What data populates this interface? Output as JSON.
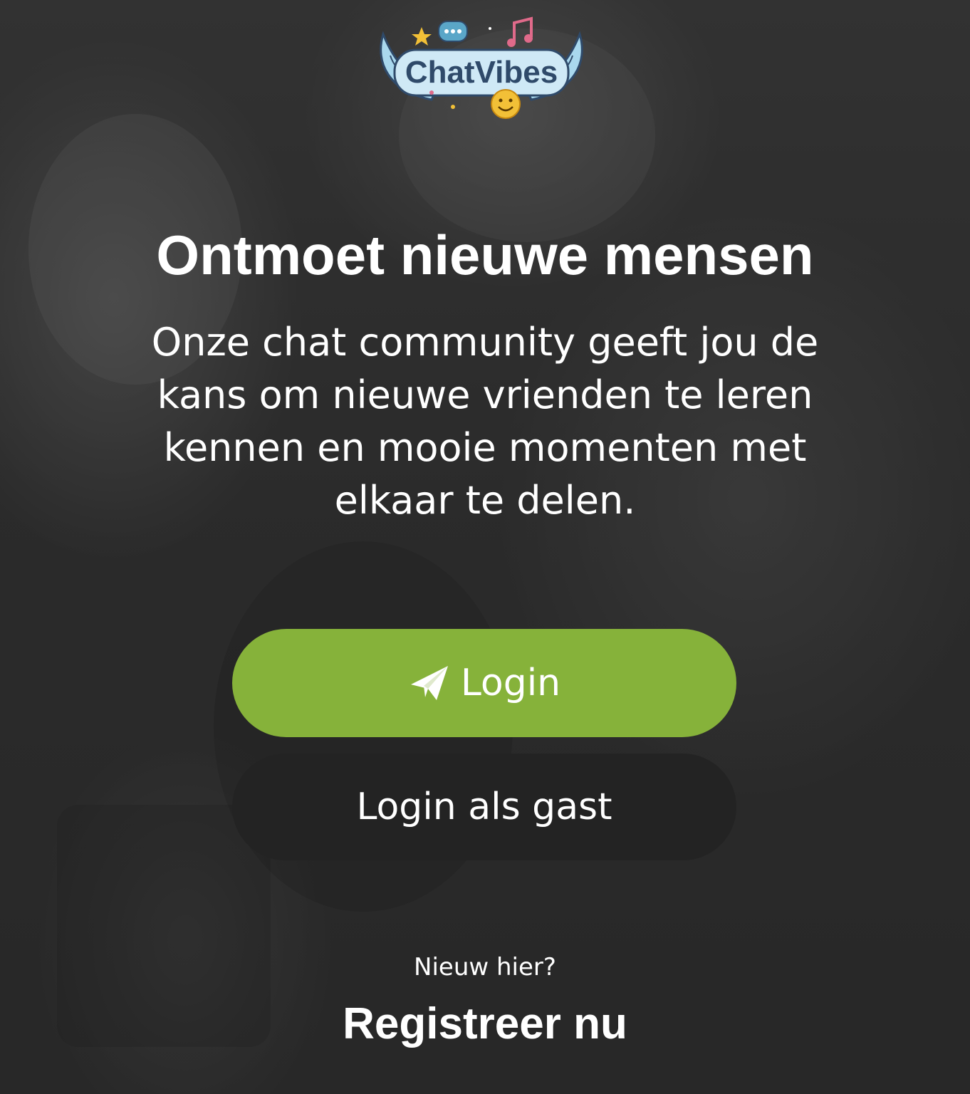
{
  "brand": {
    "logo_text": "ChatVibes",
    "colors": {
      "primary_button": "#86b23a",
      "secondary_button": "#232323",
      "text": "#ffffff"
    }
  },
  "hero": {
    "headline": "Ontmoet nieuwe mensen",
    "tagline": "Onze chat community geeft jou de kans om nieuwe vrienden te leren kennen en mooie momenten met elkaar te delen."
  },
  "actions": {
    "login_label": "Login",
    "login_icon": "paper-plane-icon",
    "guest_label": "Login als gast"
  },
  "register": {
    "prompt": "Nieuw hier?",
    "link_label": "Registreer nu"
  }
}
